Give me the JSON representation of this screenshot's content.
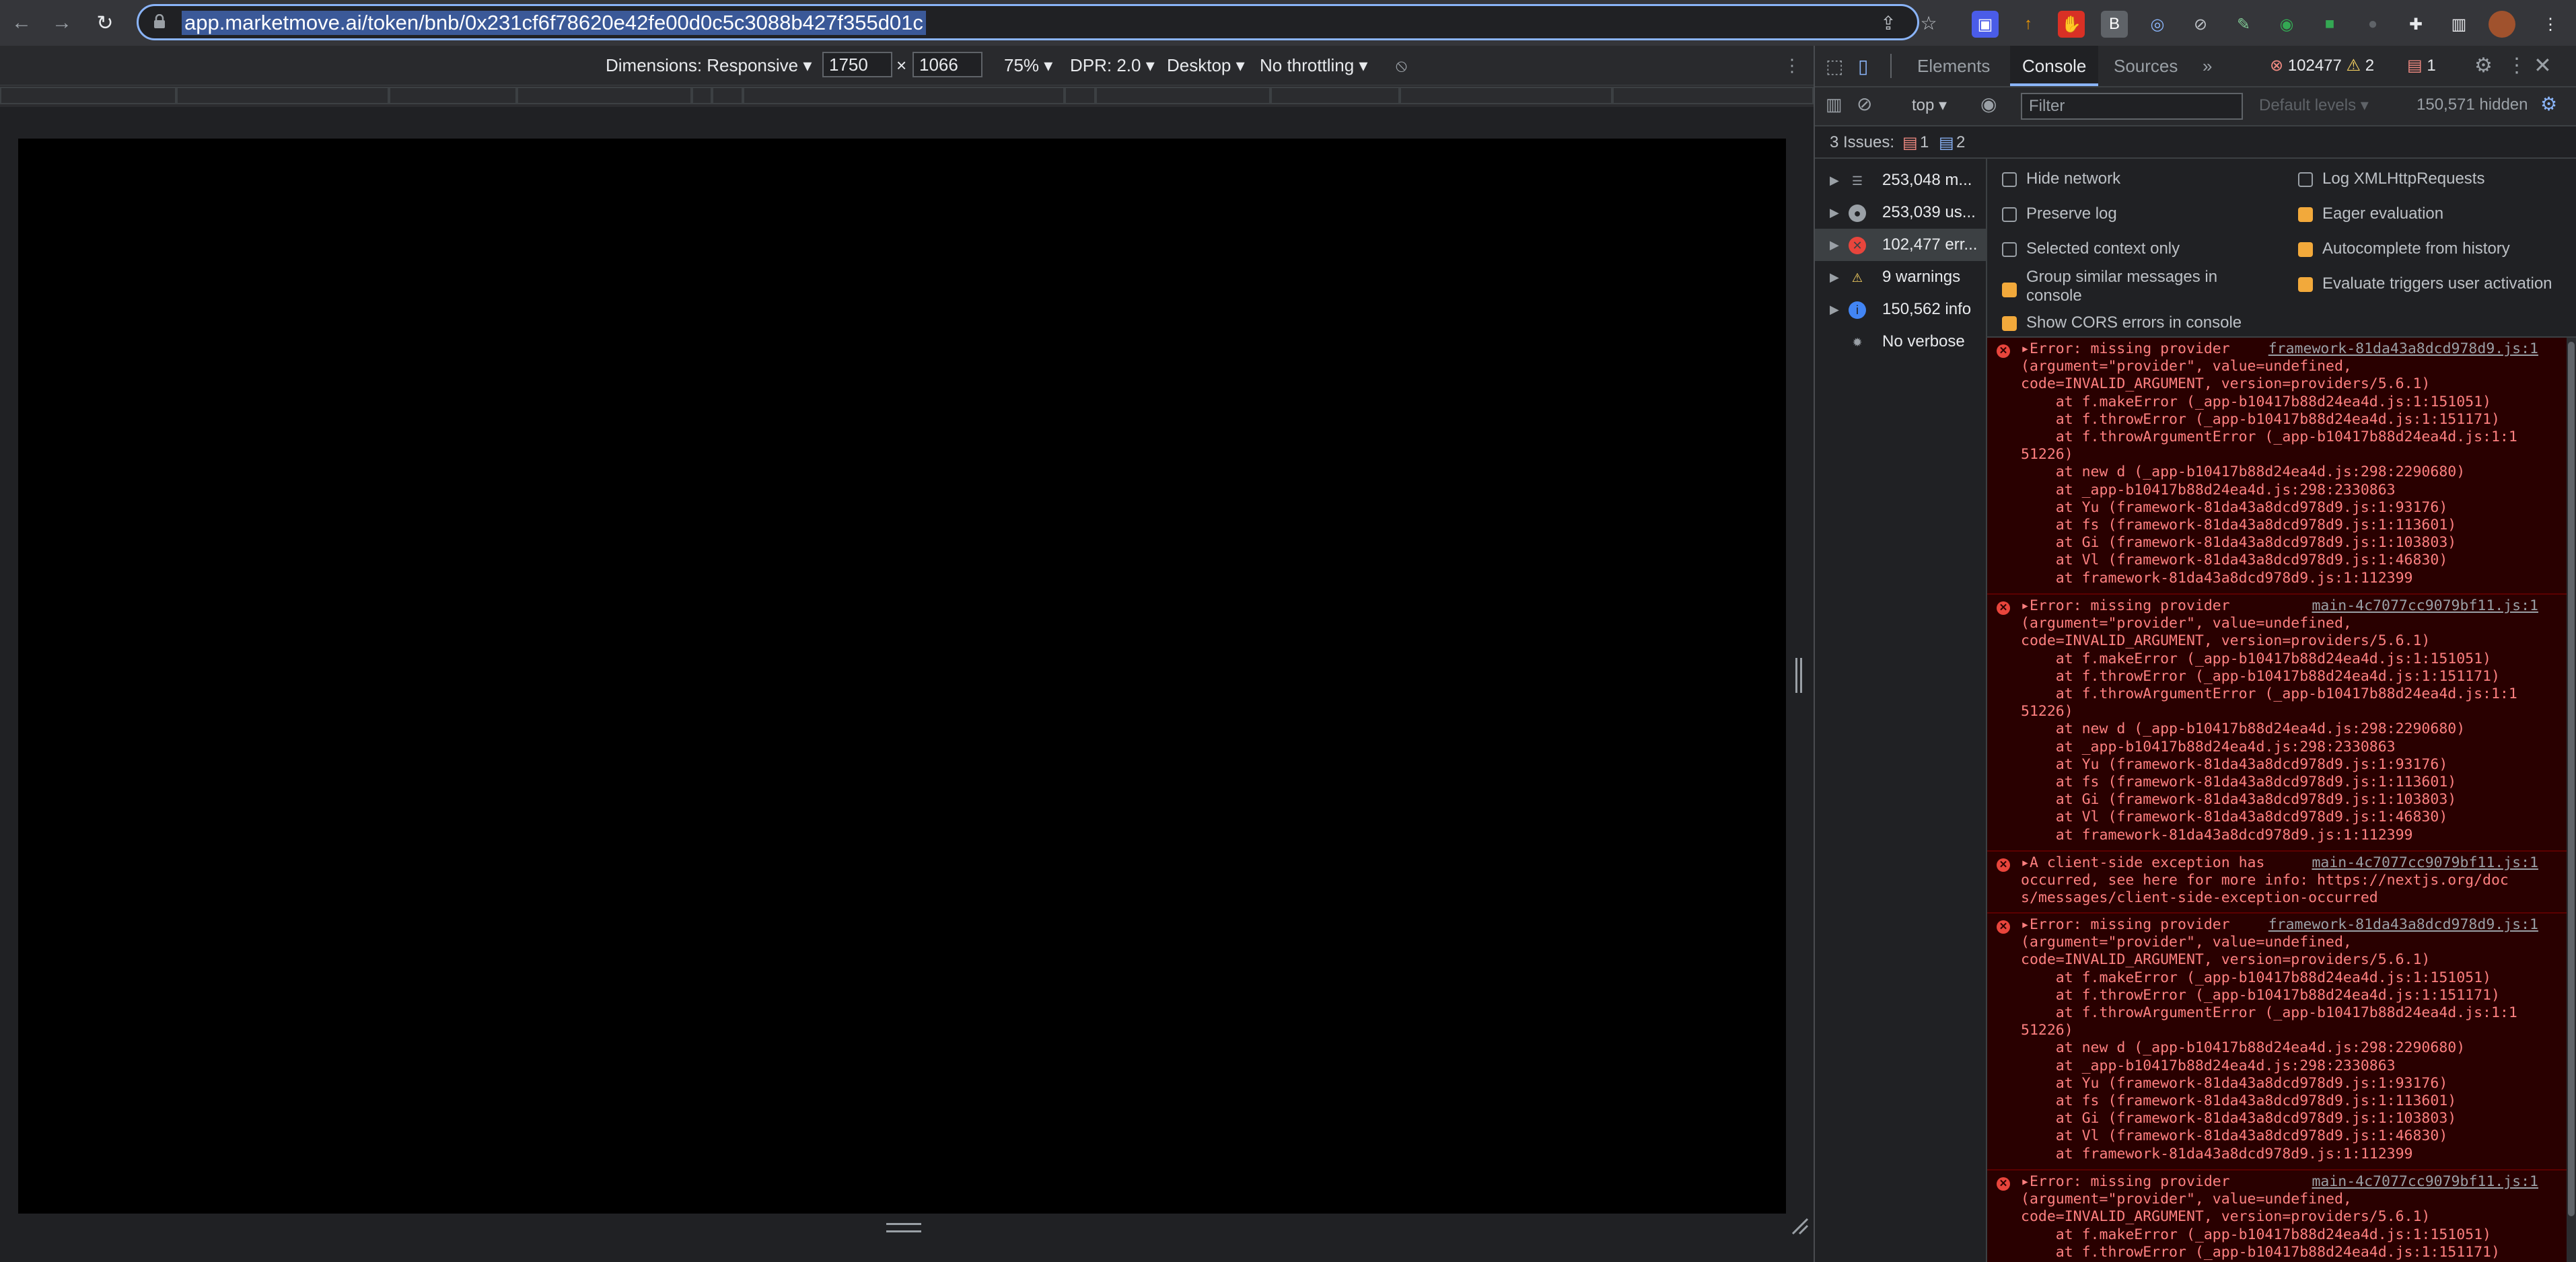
{
  "browser": {
    "url": "app.marketmove.ai/token/bnb/0x231cf6f78620e42fe00d0c5c3088b427f355d01c",
    "nav_icons": [
      "back-arrow-icon",
      "forward-arrow-icon",
      "reload-icon"
    ]
  },
  "device_toolbar": {
    "dimensions_label": "Dimensions: Responsive ▾",
    "width_value": "1750",
    "times": "×",
    "height_value": "1066",
    "zoom": "75% ▾",
    "dpr": "DPR: 2.0 ▾",
    "mode": "Desktop ▾",
    "throttle": "No throttling ▾"
  },
  "devtools": {
    "tabs": [
      "Elements",
      "Console",
      "Sources",
      "»"
    ],
    "active_tab": "Console",
    "error_count": "102477",
    "warning_count": "2",
    "issue_count": "1",
    "context": "top ▾",
    "filter_placeholder": "Filter",
    "levels": "Default levels ▾",
    "hidden": "150,571 hidden",
    "issues_text": "3 Issues:",
    "issues_err": "1",
    "issues_info": "2",
    "sidebar": [
      {
        "label": "253,048 m...",
        "icon": "list-icon"
      },
      {
        "label": "253,039 us...",
        "icon": "user-icon"
      },
      {
        "label": "102,477 err...",
        "icon": "error-icon"
      },
      {
        "label": "9 warnings",
        "icon": "warning-icon"
      },
      {
        "label": "150,562 info",
        "icon": "info-icon"
      },
      {
        "label": "No verbose",
        "icon": "bug-icon"
      }
    ],
    "settings_left": [
      {
        "label": "Hide network",
        "checked": false
      },
      {
        "label": "Preserve log",
        "checked": false
      },
      {
        "label": "Selected context only",
        "checked": false
      },
      {
        "label": "Group similar messages in console",
        "checked": true
      },
      {
        "label": "Show CORS errors in console",
        "checked": true
      }
    ],
    "settings_right": [
      {
        "label": "Log XMLHttpRequests",
        "checked": false
      },
      {
        "label": "Eager evaluation",
        "checked": true
      },
      {
        "label": "Autocomplete from history",
        "checked": true
      },
      {
        "label": "Evaluate triggers user activation",
        "checked": true
      }
    ],
    "logs": [
      {
        "source": "framework-81da43a8dcd978d9.js:1",
        "text": "▸Error: missing provider\n(argument=\"provider\", value=undefined,\ncode=INVALID_ARGUMENT, version=providers/5.6.1)\n    at f.makeError (_app-b10417b88d24ea4d.js:1:151051)\n    at f.throwError (_app-b10417b88d24ea4d.js:1:151171)\n    at f.throwArgumentError (_app-b10417b88d24ea4d.js:1:1\n51226)\n    at new d (_app-b10417b88d24ea4d.js:298:2290680)\n    at _app-b10417b88d24ea4d.js:298:2330863\n    at Yu (framework-81da43a8dcd978d9.js:1:93176)\n    at fs (framework-81da43a8dcd978d9.js:1:113601)\n    at Gi (framework-81da43a8dcd978d9.js:1:103803)\n    at Vl (framework-81da43a8dcd978d9.js:1:46830)\n    at framework-81da43a8dcd978d9.js:1:112399"
      },
      {
        "source": "main-4c7077cc9079bf11.js:1",
        "text": "▸Error: missing provider\n(argument=\"provider\", value=undefined,\ncode=INVALID_ARGUMENT, version=providers/5.6.1)\n    at f.makeError (_app-b10417b88d24ea4d.js:1:151051)\n    at f.throwError (_app-b10417b88d24ea4d.js:1:151171)\n    at f.throwArgumentError (_app-b10417b88d24ea4d.js:1:1\n51226)\n    at new d (_app-b10417b88d24ea4d.js:298:2290680)\n    at _app-b10417b88d24ea4d.js:298:2330863\n    at Yu (framework-81da43a8dcd978d9.js:1:93176)\n    at fs (framework-81da43a8dcd978d9.js:1:113601)\n    at Gi (framework-81da43a8dcd978d9.js:1:103803)\n    at Vl (framework-81da43a8dcd978d9.js:1:46830)\n    at framework-81da43a8dcd978d9.js:1:112399"
      },
      {
        "source": "main-4c7077cc9079bf11.js:1",
        "text": "▸A client-side exception has\noccurred, see here for more info: https://nextjs.org/doc\ns/messages/client-side-exception-occurred"
      },
      {
        "source": "framework-81da43a8dcd978d9.js:1",
        "text": "▸Error: missing provider\n(argument=\"provider\", value=undefined,\ncode=INVALID_ARGUMENT, version=providers/5.6.1)\n    at f.makeError (_app-b10417b88d24ea4d.js:1:151051)\n    at f.throwError (_app-b10417b88d24ea4d.js:1:151171)\n    at f.throwArgumentError (_app-b10417b88d24ea4d.js:1:1\n51226)\n    at new d (_app-b10417b88d24ea4d.js:298:2290680)\n    at _app-b10417b88d24ea4d.js:298:2330863\n    at Yu (framework-81da43a8dcd978d9.js:1:93176)\n    at fs (framework-81da43a8dcd978d9.js:1:113601)\n    at Gi (framework-81da43a8dcd978d9.js:1:103803)\n    at Vl (framework-81da43a8dcd978d9.js:1:46830)\n    at framework-81da43a8dcd978d9.js:1:112399"
      },
      {
        "source": "main-4c7077cc9079bf11.js:1",
        "text": "▸Error: missing provider\n(argument=\"provider\", value=undefined,\ncode=INVALID_ARGUMENT, version=providers/5.6.1)\n    at f.makeError (_app-b10417b88d24ea4d.js:1:151051)\n    at f.throwError (_app-b10417b88d24ea4d.js:1:151171)"
      }
    ]
  }
}
